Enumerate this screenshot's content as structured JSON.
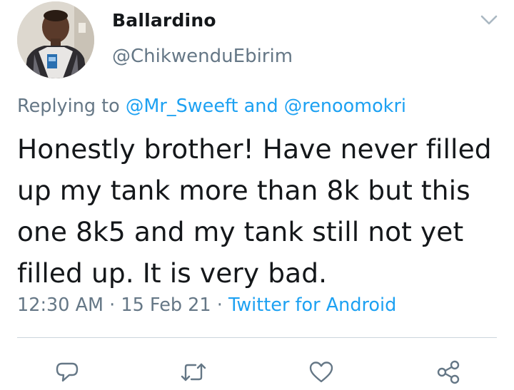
{
  "tweet": {
    "author": {
      "display_name": "Ballardino",
      "handle": "@ChikwenduEbirim"
    },
    "reply_prefix": "Replying to",
    "reply_mention_1": "@Mr_Sweeft",
    "reply_and": "and",
    "reply_mention_2": "@renoomokri",
    "text_lines": [
      "Honestly brother! Have never filled",
      "up my tank more than 8k but this",
      "one 8k5 and my tank still not yet",
      "filled up.  It is very bad."
    ],
    "time": "12:30 AM",
    "date": "15 Feb 21",
    "separator": "·",
    "source": "Twitter for Android"
  },
  "actions": [
    "reply-icon",
    "retweet-icon",
    "like-icon",
    "share-icon"
  ],
  "colors": {
    "text": "#14171a",
    "secondary": "#657786",
    "link": "#1da1f2",
    "divider": "#ccd6dd"
  }
}
